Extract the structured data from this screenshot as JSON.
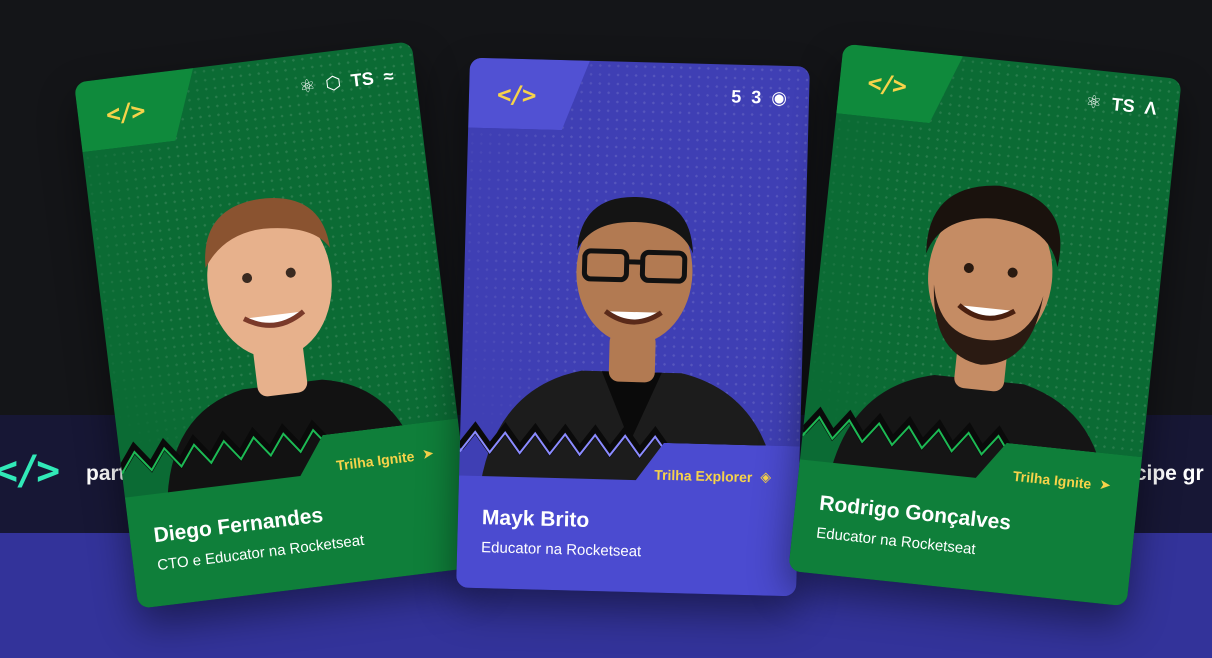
{
  "band": {
    "left_text": "parti",
    "right_text": "ticipe gr",
    "icon": "code-brackets-icon"
  },
  "cards": [
    {
      "name": "Diego Fernandes",
      "role": "CTO e Educator na Rocketseat",
      "trail": "Trilha Ignite",
      "trail_icon": "paper-plane-icon",
      "logo": "</>",
      "techs": [
        "react-icon",
        "nodejs-icon",
        "TS",
        "tailwind-icon"
      ],
      "color": "#0b6b34"
    },
    {
      "name": "Mayk Brito",
      "role": "Educator na Rocketseat",
      "trail": "Trilha Explorer",
      "trail_icon": "compass-icon",
      "logo": "</>",
      "techs": [
        "html5-icon",
        "css3-icon",
        "github-icon"
      ],
      "color": "#3f3fb4"
    },
    {
      "name": "Rodrigo Gonçalves",
      "role": "Educator na Rocketseat",
      "trail": "Trilha Ignite",
      "trail_icon": "paper-plane-icon",
      "logo": "</>",
      "techs": [
        "react-icon",
        "TS",
        "caret-up-icon"
      ],
      "color": "#0b6b34"
    }
  ]
}
